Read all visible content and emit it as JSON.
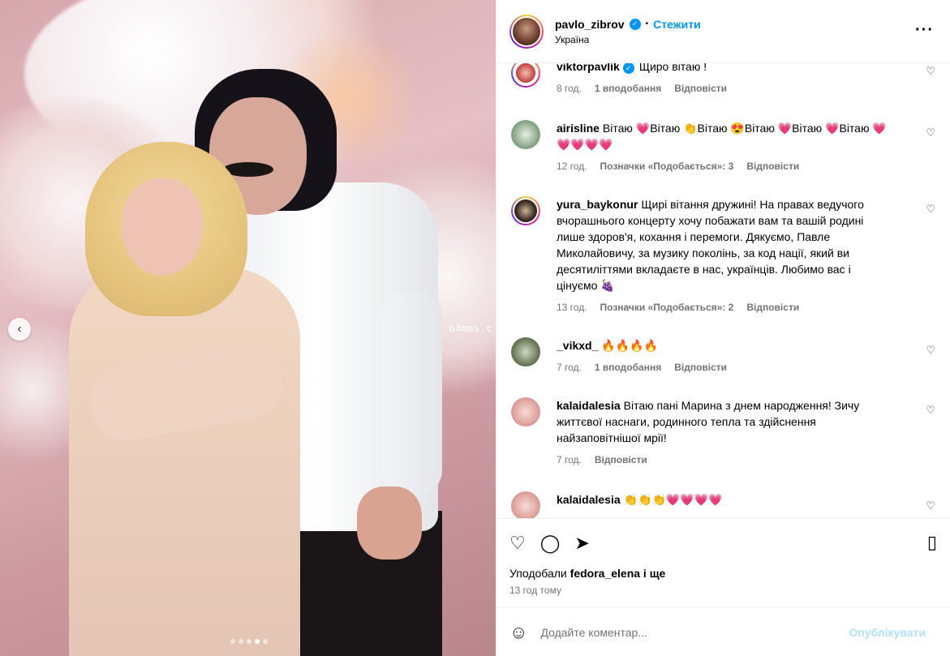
{
  "post": {
    "username": "pavlo_zibrov",
    "follow_label": "Стежити",
    "location": "Україна",
    "more_icon": "more-horizontal-icon",
    "watermark": "b4mms.c",
    "carousel": {
      "slides": 5,
      "active_index": 3
    }
  },
  "colors": {
    "accent_blue": "#0095f6",
    "meta_gray": "#737373",
    "post_disabled": "#b2dffc"
  },
  "comments": [
    {
      "user": "viktorpavlik",
      "verified": true,
      "text": "Щиро вітаю !",
      "time": "8 год.",
      "likes": "1 вподобання",
      "reply": "Відповісти"
    },
    {
      "user": "airisline",
      "verified": false,
      "text": "Вітаю 💗Вітаю 👏Вітаю 😍Вітаю 💗Вітаю 💗Вітаю 💗💗💗💗💗",
      "time": "12 год.",
      "likes": "Позначки «Подобається»: 3",
      "reply": "Відповісти"
    },
    {
      "user": "yura_baykonur",
      "verified": false,
      "text": "Щирі вітання дружині! На правах ведучого вчорашнього концерту хочу побажати вам та вашій родині лише здоров'я, кохання і перемоги. Дякуємо, Павле Миколайовичу, за музику поколінь, за код нації, який ви десятиліттями вкладаєте в нас, українців. Любимо вас і цінуємо 🍇",
      "time": "13 год.",
      "likes": "Позначки «Подобається»: 2",
      "reply": "Відповісти"
    },
    {
      "user": "_vikxd_",
      "verified": false,
      "text": "🔥🔥🔥🔥",
      "time": "7 год.",
      "likes": "1 вподобання",
      "reply": "Відповісти"
    },
    {
      "user": "kalaidalesia",
      "verified": false,
      "text": "Вітаю пані Марина з днем народження! Зичу життєвої наснаги, родинного тепла та здійснення найзаповітнішої мрії!",
      "time": "7 год.",
      "likes": "",
      "reply": "Відповісти"
    },
    {
      "user": "kalaidalesia",
      "verified": false,
      "text": "👏👏👏💗💗💗💗",
      "time": "",
      "likes": "",
      "reply": ""
    }
  ],
  "actions": {
    "like_icon": "heart-icon",
    "comment_icon": "comment-icon",
    "share_icon": "send-icon",
    "save_icon": "bookmark-icon"
  },
  "likes_line": {
    "prefix": "Уподобали",
    "user": "fedora_elena",
    "suffix": "і ще"
  },
  "time_ago": "13 год тому",
  "add_comment": {
    "placeholder": "Додайте коментар...",
    "post_label": "Опублікувати"
  }
}
